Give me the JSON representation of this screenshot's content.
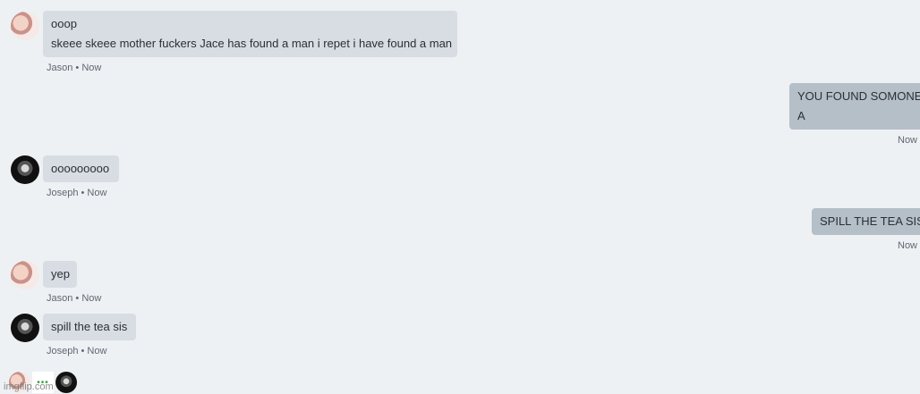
{
  "messages": [
    {
      "sender": "Jason",
      "lines": [
        "ooop",
        "skeee skeee mother fuckers Jace has found a man i repet i have found a man"
      ],
      "meta": "Jason • Now"
    },
    {
      "outgoing": true,
      "lines": [
        "YOU FOUND SOMONE?",
        "A"
      ],
      "meta": "Now"
    },
    {
      "sender": "Joseph",
      "lines": [
        "ooooooooo"
      ],
      "meta": "Joseph • Now"
    },
    {
      "outgoing": true,
      "lines": [
        "SPILL THE TEA SIS"
      ],
      "meta": "Now"
    },
    {
      "sender": "Jason",
      "lines": [
        "yep"
      ],
      "meta": "Jason • Now"
    },
    {
      "sender": "Joseph",
      "lines": [
        "spill the tea sis"
      ],
      "meta": "Joseph • Now"
    }
  ],
  "typing": {
    "dots": "•••"
  },
  "watermark": "imgflip.com"
}
